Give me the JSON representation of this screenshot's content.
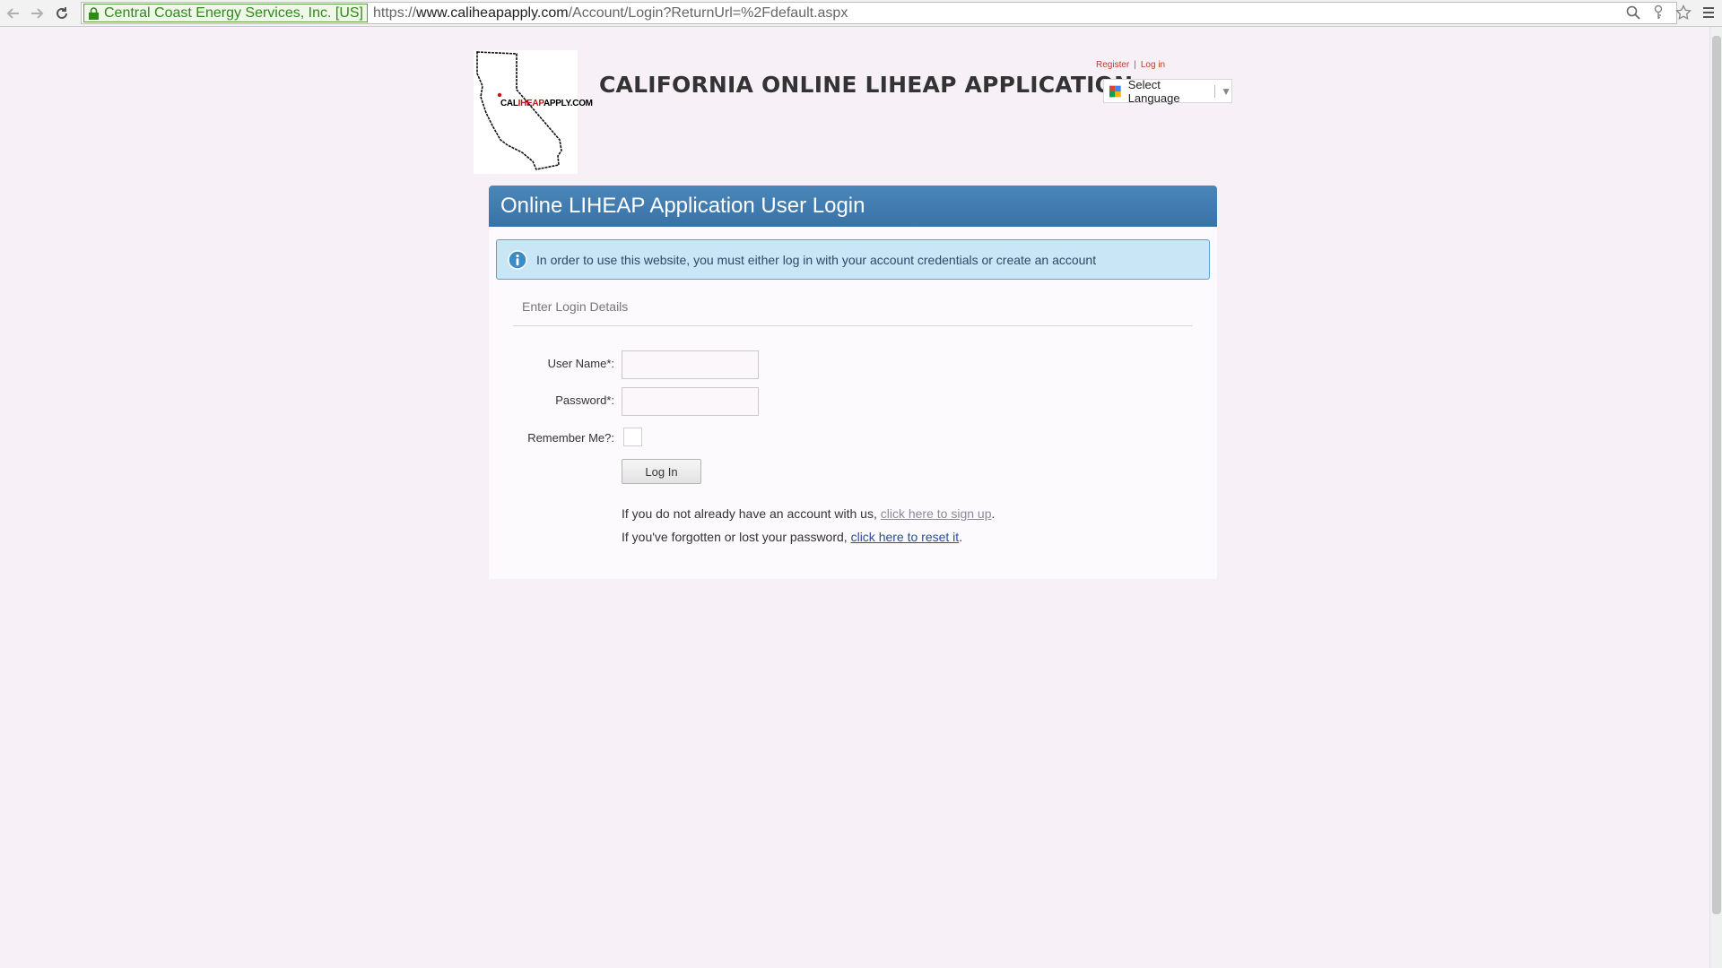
{
  "browser": {
    "ev_label": "Central Coast Energy Services, Inc. [US]",
    "url_scheme": "https://",
    "url_host": "www.caliheapapply.com",
    "url_path": "/Account/Login?ReturnUrl=%2Fdefault.aspx"
  },
  "header": {
    "logo_prefix": "CAL",
    "logo_mid": "IHEAP",
    "logo_suffix": "APPLY.COM",
    "title": "CALIFORNIA ONLINE LIHEAP APPLICATION",
    "register_link": "Register",
    "separator": "|",
    "login_link": "Log in",
    "language_label": "Select Language"
  },
  "panel": {
    "title": "Online LIHEAP Application User Login",
    "info_message": "In order to use this website, you must either log in with your account credentials or create an account",
    "section_label": "Enter Login Details",
    "username_label": "User Name*:",
    "username_value": "",
    "password_label": "Password*:",
    "password_value": "",
    "remember_label": "Remember Me?:",
    "login_button": "Log In",
    "signup_prefix": "If you do not already have an account with us, ",
    "signup_link": "click here to sign up",
    "signup_suffix": ".",
    "reset_prefix": "If you've forgotten or lost your password, ",
    "reset_link": "click here to reset it",
    "reset_suffix": "."
  },
  "colors": {
    "page_background": "#f7f1f7",
    "header_blue": "#3f7aae",
    "info_background": "#c9e6f7",
    "top_link_red": "#c0392b"
  },
  "icons": [
    "back-arrow-icon",
    "forward-arrow-icon",
    "reload-icon",
    "lock-icon",
    "search-icon",
    "key-icon",
    "star-icon",
    "menu-icon",
    "google-translate-icon",
    "info-icon",
    "california-map-icon"
  ]
}
